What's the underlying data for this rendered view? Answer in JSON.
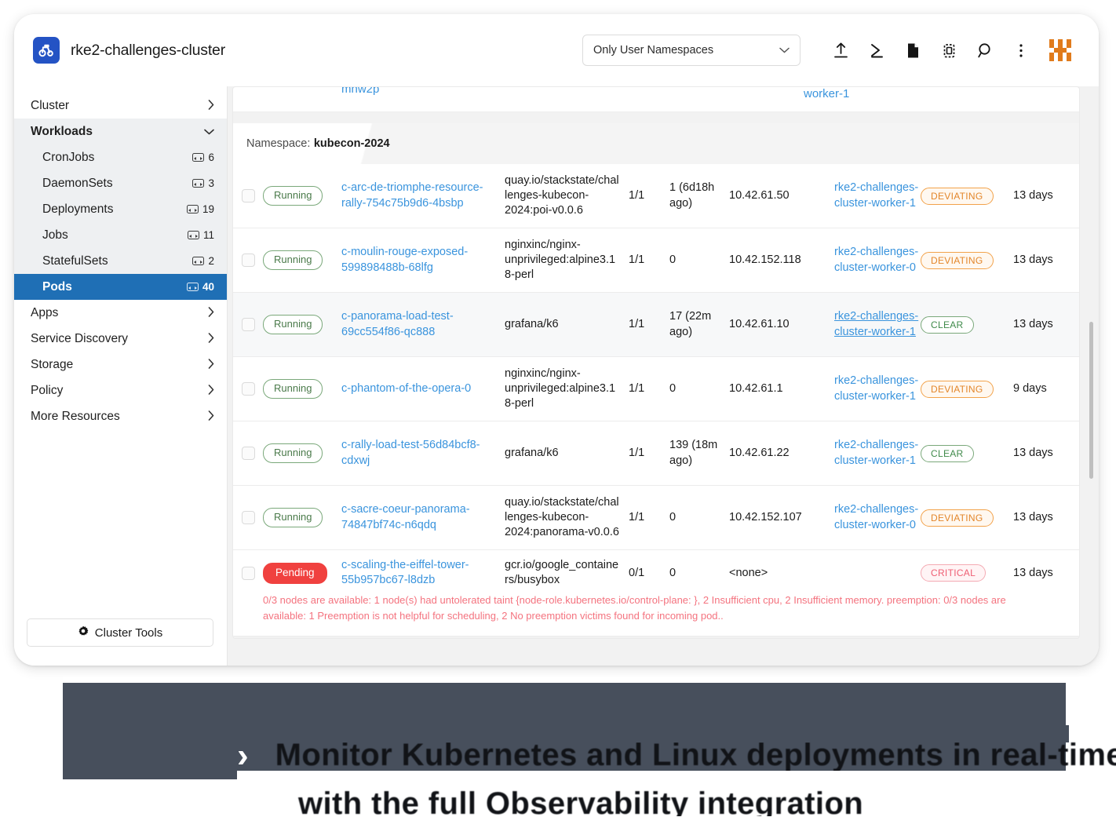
{
  "header": {
    "cluster_name": "rke2-challenges-cluster",
    "logo_icon": "cluster-logo-icon",
    "namespace_filter": {
      "value": "Only User Namespaces",
      "chevron_icon": "chevron-down-icon"
    },
    "tools": [
      {
        "name": "import-yaml-icon",
        "glyph": "upload"
      },
      {
        "name": "kubectl-shell-icon",
        "glyph": "shell"
      },
      {
        "name": "kubeconfig-file-icon",
        "glyph": "file"
      },
      {
        "name": "copy-kubeconfig-icon",
        "glyph": "copy"
      },
      {
        "name": "search-icon",
        "glyph": "search"
      },
      {
        "name": "more-menu-icon",
        "glyph": "kebab"
      }
    ],
    "avatar_name": "user-avatar",
    "avatar_color": "#e07b1c"
  },
  "sidebar": {
    "groups": [
      {
        "label": "Cluster",
        "state": "collapsed",
        "icon": "chevron-right-icon"
      },
      {
        "label": "Workloads",
        "state": "expanded",
        "icon": "chevron-down-icon"
      }
    ],
    "workload_items": [
      {
        "label": "CronJobs",
        "count": "6",
        "active": false
      },
      {
        "label": "DaemonSets",
        "count": "3",
        "active": false
      },
      {
        "label": "Deployments",
        "count": "19",
        "active": false
      },
      {
        "label": "Jobs",
        "count": "11",
        "active": false
      },
      {
        "label": "StatefulSets",
        "count": "2",
        "active": false
      },
      {
        "label": "Pods",
        "count": "40",
        "active": true
      }
    ],
    "groups_after": [
      {
        "label": "Apps",
        "state": "collapsed",
        "icon": "chevron-right-icon"
      },
      {
        "label": "Service Discovery",
        "state": "collapsed",
        "icon": "chevron-right-icon"
      },
      {
        "label": "Storage",
        "state": "collapsed",
        "icon": "chevron-right-icon"
      },
      {
        "label": "Policy",
        "state": "collapsed",
        "icon": "chevron-right-icon"
      },
      {
        "label": "More Resources",
        "state": "collapsed",
        "icon": "chevron-right-icon"
      }
    ],
    "cluster_tools": {
      "label": "Cluster Tools",
      "icon": "gear-icon"
    },
    "active_accent": "#1f6fb5"
  },
  "table": {
    "cut_row_top": {
      "name_fragment": "mnw2p",
      "node_fragment": "worker-1"
    },
    "namespace_band": {
      "label": "Namespace:",
      "value": "kubecon-2024"
    },
    "rows": [
      {
        "state": "Running",
        "state_kind": "running",
        "name": "c-arc-de-triomphe-resource-rally-754c75b9d6-4bsbp",
        "image": "quay.io/stackstate/challenges-kubecon-2024:poi-v0.0.6",
        "ready": "1/1",
        "restarts": "1 (6d18h ago)",
        "ip": "10.42.61.50",
        "node": "rke2-challenges-cluster-worker-1",
        "health": "DEVIATING",
        "health_kind": "deviating",
        "age": "13 days",
        "hovered": false,
        "error": null
      },
      {
        "state": "Running",
        "state_kind": "running",
        "name": "c-moulin-rouge-exposed-599898488b-68lfg",
        "image": "nginxinc/nginx-unprivileged:alpine3.18-perl",
        "ready": "1/1",
        "restarts": "0",
        "ip": "10.42.152.118",
        "node": "rke2-challenges-cluster-worker-0",
        "health": "DEVIATING",
        "health_kind": "deviating",
        "age": "13 days",
        "hovered": false,
        "error": null
      },
      {
        "state": "Running",
        "state_kind": "running",
        "name": "c-panorama-load-test-69cc554f86-qc888",
        "image": "grafana/k6",
        "ready": "1/1",
        "restarts": "17 (22m ago)",
        "ip": "10.42.61.10",
        "node": "rke2-challenges-cluster-worker-1",
        "health": "CLEAR",
        "health_kind": "clear",
        "age": "13 days",
        "hovered": true,
        "error": null
      },
      {
        "state": "Running",
        "state_kind": "running",
        "name": "c-phantom-of-the-opera-0",
        "image": "nginxinc/nginx-unprivileged:alpine3.18-perl",
        "ready": "1/1",
        "restarts": "0",
        "ip": "10.42.61.1",
        "node": "rke2-challenges-cluster-worker-1",
        "health": "DEVIATING",
        "health_kind": "deviating",
        "age": "9 days",
        "hovered": false,
        "error": null
      },
      {
        "state": "Running",
        "state_kind": "running",
        "name": "c-rally-load-test-56d84bcf8-cdxwj",
        "image": "grafana/k6",
        "ready": "1/1",
        "restarts": "139 (18m ago)",
        "ip": "10.42.61.22",
        "node": "rke2-challenges-cluster-worker-1",
        "health": "CLEAR",
        "health_kind": "clear",
        "age": "13 days",
        "hovered": false,
        "error": null
      },
      {
        "state": "Running",
        "state_kind": "running",
        "name": "c-sacre-coeur-panorama-74847bf74c-n6qdq",
        "image": "quay.io/stackstate/challenges-kubecon-2024:panorama-v0.0.6",
        "ready": "1/1",
        "restarts": "0",
        "ip": "10.42.152.107",
        "node": "rke2-challenges-cluster-worker-0",
        "health": "DEVIATING",
        "health_kind": "deviating",
        "age": "13 days",
        "hovered": false,
        "error": null
      },
      {
        "state": "Pending",
        "state_kind": "pending",
        "name": "c-scaling-the-eiffel-tower-55b957bc67-l8dzb",
        "image": "gcr.io/google_containers/busybox",
        "ready": "0/1",
        "restarts": "0",
        "ip": "<none>",
        "node": "",
        "health": "CRITICAL",
        "health_kind": "critical",
        "age": "13 days",
        "hovered": false,
        "error": "0/3 nodes are available: 1 node(s) had untolerated taint {node-role.kubernetes.io/control-plane: }, 2 Insufficient cpu, 2 Insufficient memory. preemption: 0/3 nodes are available: 1 Preemption is not helpful for scheduling, 2 No preemption victims found for incoming pod.."
      }
    ],
    "colors": {
      "link": "#3a94dd",
      "running": "#4a7a4a",
      "pending": "#f0413f",
      "deviating": "#e3862a",
      "clear": "#3f8a4a",
      "critical": "#ef5f74",
      "error_text": "#f4737f"
    }
  },
  "banner": {
    "background": "#474f5c",
    "chevron_icon": "chevron-right-icon",
    "line1": "Monitor Kubernetes and Linux deployments in real-time",
    "line2": "with the full Observability integration"
  }
}
